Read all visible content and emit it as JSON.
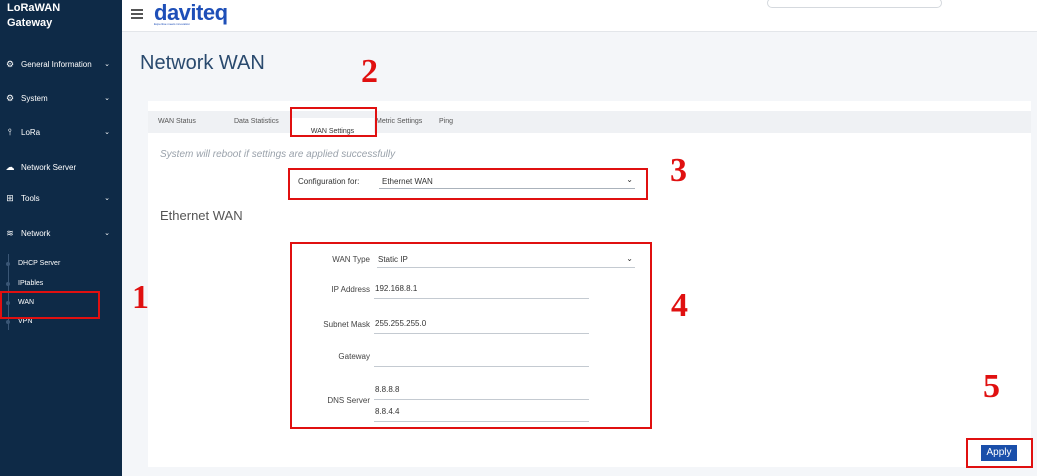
{
  "sidebar": {
    "brand_line1": "LoRaWAN",
    "brand_line2": "Gateway",
    "items": [
      {
        "label": "General Information",
        "icon": "gear-icon",
        "glyph": "⚙",
        "has_chevron": true
      },
      {
        "label": "System",
        "icon": "gear-icon",
        "glyph": "⚙",
        "has_chevron": true
      },
      {
        "label": "LoRa",
        "icon": "antenna-icon",
        "glyph": "⫯",
        "has_chevron": true
      },
      {
        "label": "Network Server",
        "icon": "cloud-icon",
        "glyph": "☁",
        "has_chevron": false
      },
      {
        "label": "Tools",
        "icon": "grid-icon",
        "glyph": "⊞",
        "has_chevron": true
      },
      {
        "label": "Network",
        "icon": "wifi-icon",
        "glyph": "≋",
        "has_chevron": true
      }
    ],
    "sub_items": [
      "DHCP Server",
      "IPtables",
      "WAN",
      "VPN"
    ],
    "active_sub_item": "WAN",
    "chevron_glyph": "⌄"
  },
  "header": {
    "logo": "daviteq",
    "logo_tagline": "Expertise meets innovation"
  },
  "page": {
    "title": "Network WAN",
    "tabs": [
      "WAN Status",
      "Data Statistics",
      "WAN Settings",
      "Metric Settings",
      "Ping"
    ],
    "active_tab": "WAN Settings",
    "notice": "System will reboot if settings are applied successfully",
    "config_label": "Configuration for:",
    "config_value": "Ethernet WAN",
    "section_title": "Ethernet WAN",
    "form": {
      "wan_type_label": "WAN Type",
      "wan_type_value": "Static IP",
      "ip_label": "IP Address",
      "ip_value": "192.168.8.1",
      "subnet_label": "Subnet Mask",
      "subnet_value": "255.255.255.0",
      "gateway_label": "Gateway",
      "gateway_value": "",
      "dns_label": "DNS Server",
      "dns1_value": "8.8.8.8",
      "dns2_value": "8.8.4.4"
    },
    "apply_label": "Apply"
  },
  "annotations": {
    "n1": "1",
    "n2": "2",
    "n3": "3",
    "n4": "4",
    "n5": "5",
    "color": "#e01010"
  },
  "colors": {
    "sidebar_bg": "#0e2a47",
    "accent": "#1a4faa",
    "title": "#2a4a6e"
  }
}
